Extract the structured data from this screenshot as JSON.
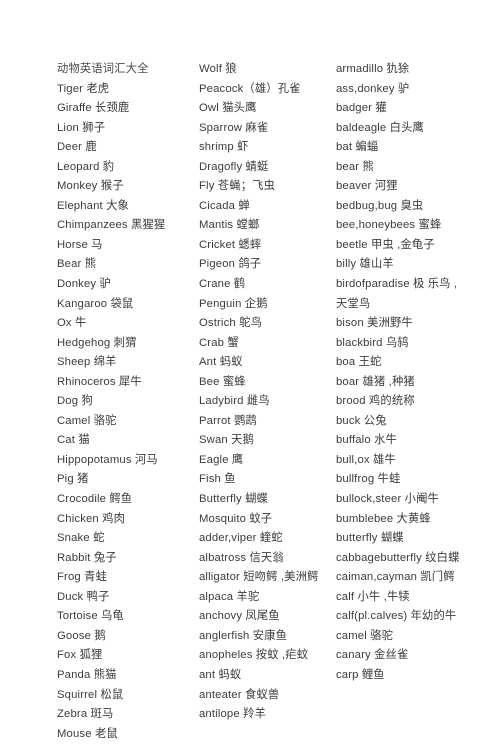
{
  "document": {
    "title": "动物英语词汇大全",
    "page_background": "#ffffff",
    "text_color": "#3c3c3c",
    "column_count": 3
  },
  "columns": [
    {
      "name": "column-1",
      "entries": [
        "动物英语词汇大全",
        "Tiger 老虎",
        "Giraffe 长颈鹿",
        "Lion 狮子",
        "Deer 鹿",
        "Leopard 豹",
        "Monkey 猴子",
        "Elephant 大象",
        "Chimpanzees 黑猩猩",
        "Horse 马",
        "Bear 熊",
        "Donkey 驴",
        "Kangaroo 袋鼠",
        "Ox 牛",
        "Hedgehog 刺猬",
        "Sheep 绵羊",
        "Rhinoceros 犀牛",
        "Dog 狗",
        "Camel 骆驼",
        "Cat 猫",
        "Hippopotamus 河马",
        "Pig 猪",
        "Crocodile 鳄鱼",
        "Chicken 鸡肉",
        "Snake 蛇",
        "Rabbit 兔子",
        "Frog 青蛙",
        "Duck 鸭子",
        "Tortoise 乌龟",
        "Goose 鹅",
        "Fox 狐狸",
        "Panda 熊猫",
        "Squirrel 松鼠",
        "Zebra 斑马",
        "Mouse 老鼠"
      ]
    },
    {
      "name": "column-2",
      "entries": [
        "Wolf 狼",
        "Peacock（雄）孔雀",
        "Owl 猫头鹰",
        "Sparrow 麻雀",
        "shrimp 虾",
        "Dragofly 蜻蜓",
        "Fly 苍蝇；飞虫",
        "Cicada 蝉",
        "Mantis 螳螂",
        "Cricket 蟋蟀",
        "Pigeon 鸽子",
        "Crane 鹤",
        "Penguin 企鹅",
        "Ostrich 鸵鸟",
        "Crab 蟹",
        "Ant 蚂蚁",
        "Bee 蜜蜂",
        "Ladybird 雌鸟",
        "Parrot 鹦鹉",
        "Swan 天鹅",
        "Eagle 鹰",
        "Fish 鱼",
        "Butterfly 蝴蝶",
        "Mosquito 蚊子",
        "adder,viper 蝰蛇",
        "albatross 信天翁",
        "alligator 短吻鳄 ,美洲鳄",
        "alpaca 羊驼",
        "anchovy 凤尾鱼",
        "anglerfish 安康鱼",
        "anopheles 按蚊 ,疟蚊",
        "ant 蚂蚁",
        "anteater 食蚁兽",
        "antilope 羚羊"
      ]
    },
    {
      "name": "column-3",
      "entries": [
        "armadillo 犰狳",
        "ass,donkey 驴",
        "badger 獾",
        "baldeagle 白头鹰",
        "bat 蝙蝠",
        "bear 熊",
        "beaver 河狸",
        "bedbug,bug 臭虫",
        "bee,honeybees 蜜蜂",
        "beetle 甲虫 ,金龟子",
        "billy 雄山羊",
        "birdofparadise 极 乐鸟 ,天堂鸟",
        "bison 美洲野牛",
        "blackbird 乌鸫",
        "boa 王蛇",
        "boar 雄猪 ,种猪",
        "brood 鸡的统称",
        "buck 公兔",
        "buffalo 水牛",
        "bull,ox 雄牛",
        "bullfrog 牛蛙",
        "bullock,steer 小阉牛",
        "bumblebee 大黄蜂",
        "butterfly 蝴蝶",
        "cabbagebutterfly 纹白蝶",
        "caiman,cayman 凯门鳄",
        "calf 小牛 ,牛犊",
        "calf(pl.calves) 年幼的牛",
        "camel 骆驼",
        "canary 金丝雀",
        "carp 鲤鱼"
      ]
    }
  ]
}
